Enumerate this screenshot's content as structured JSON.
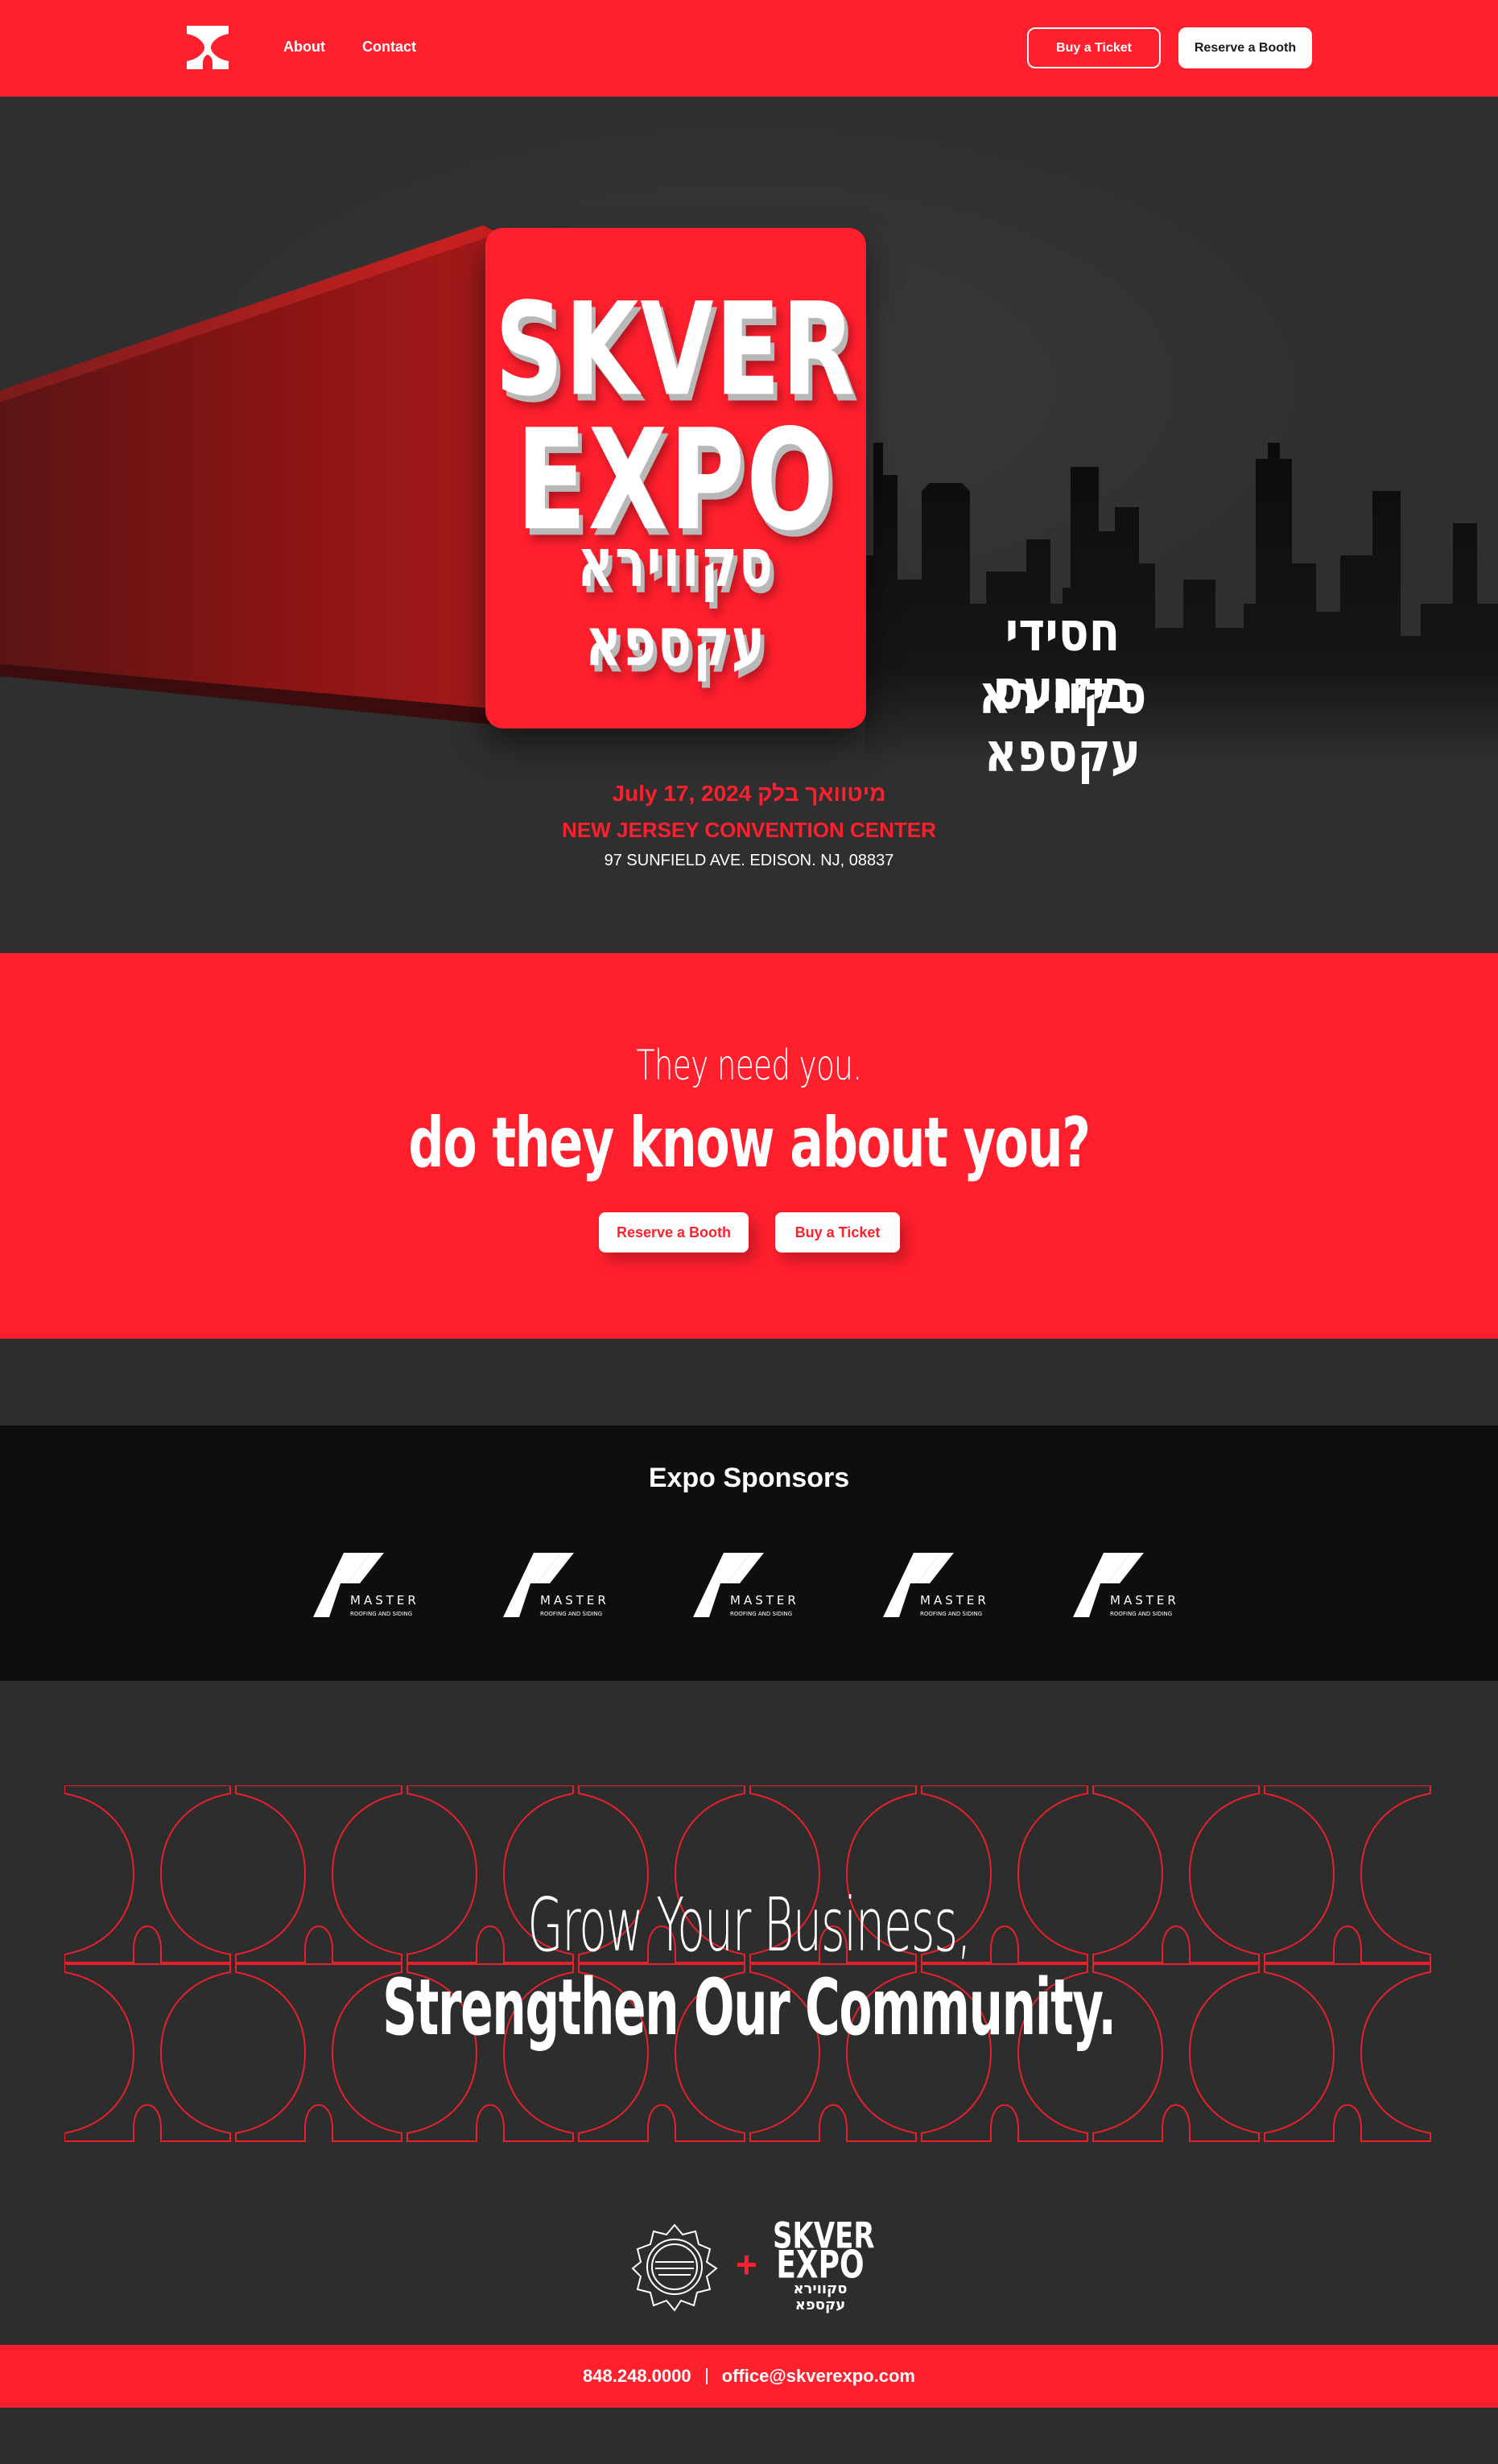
{
  "nav": {
    "logo_icon": "skver-x-logo-icon",
    "links": [
      "About",
      "Contact"
    ],
    "buy_ticket": "Buy a Ticket",
    "reserve_booth": "Reserve a Booth"
  },
  "hero": {
    "box_line1": "SKVER",
    "box_line2": "EXPO",
    "box_line3": "סקווירא עקספא",
    "tagline_line1": "חסידי סקווירא",
    "tagline_line2": "ביזנעס עקספא",
    "date": "July 17, 2024 מיטוואך בלק",
    "venue": "NEW JERSEY CONVENTION CENTER",
    "address": "97 SUNFIELD AVE. EDISON. NJ, 08837"
  },
  "cta": {
    "line1": "They need you.",
    "line2": "do they know about you?",
    "reserve_booth": "Reserve a Booth",
    "buy_ticket": "Buy a Ticket"
  },
  "sponsors": {
    "title": "Expo Sponsors",
    "items": [
      {
        "name": "MASTER",
        "sub": "ROOFING AND SIDING"
      },
      {
        "name": "MASTER",
        "sub": "ROOFING AND SIDING"
      },
      {
        "name": "MASTER",
        "sub": "ROOFING AND SIDING"
      },
      {
        "name": "MASTER",
        "sub": "ROOFING AND SIDING"
      },
      {
        "name": "MASTER",
        "sub": "ROOFING AND SIDING"
      }
    ]
  },
  "grow": {
    "line1": "Grow Your Business,",
    "line2": "Strengthen Our Community.",
    "plus": "+",
    "mini_logo_line1": "SKVER",
    "mini_logo_line2": "EXPO",
    "mini_logo_line3": "סקווירא עקספא"
  },
  "footer": {
    "phone": "848.248.0000",
    "email": "office@skverexpo.com"
  },
  "colors": {
    "brand_red": "#ff1f2d",
    "dark_bg": "#2d2d2d",
    "sponsor_bg": "#0e0e0e"
  }
}
